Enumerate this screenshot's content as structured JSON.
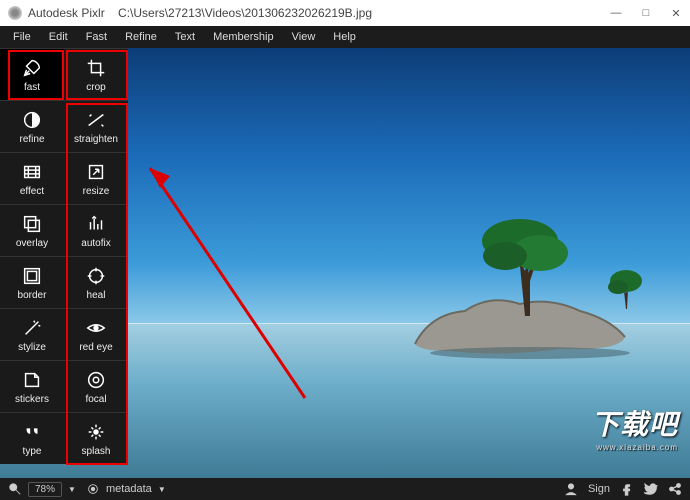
{
  "title": {
    "app": "Autodesk Pixlr",
    "path": "C:\\Users\\27213\\Videos\\201306232026219B.jpg"
  },
  "menu": [
    "File",
    "Edit",
    "Fast",
    "Refine",
    "Text",
    "Membership",
    "View",
    "Help"
  ],
  "col1": [
    {
      "label": "fast",
      "icon": "rocket",
      "selected": true
    },
    {
      "label": "refine",
      "icon": "contrast"
    },
    {
      "label": "effect",
      "icon": "film"
    },
    {
      "label": "overlay",
      "icon": "layers"
    },
    {
      "label": "border",
      "icon": "frame"
    },
    {
      "label": "stylize",
      "icon": "wand"
    },
    {
      "label": "stickers",
      "icon": "sticker"
    },
    {
      "label": "type",
      "icon": "quote"
    }
  ],
  "col2": [
    {
      "label": "crop",
      "icon": "crop"
    },
    {
      "label": "straighten",
      "icon": "straighten"
    },
    {
      "label": "resize",
      "icon": "resize"
    },
    {
      "label": "autofix",
      "icon": "autofix"
    },
    {
      "label": "heal",
      "icon": "target"
    },
    {
      "label": "red eye",
      "icon": "eye"
    },
    {
      "label": "focal",
      "icon": "focal"
    },
    {
      "label": "splash",
      "icon": "splash"
    }
  ],
  "status": {
    "zoom": "78%",
    "meta": "metadata",
    "sign": "Sign"
  },
  "watermark": {
    "main": "下载吧",
    "url": "www.xiazaiba.com"
  }
}
